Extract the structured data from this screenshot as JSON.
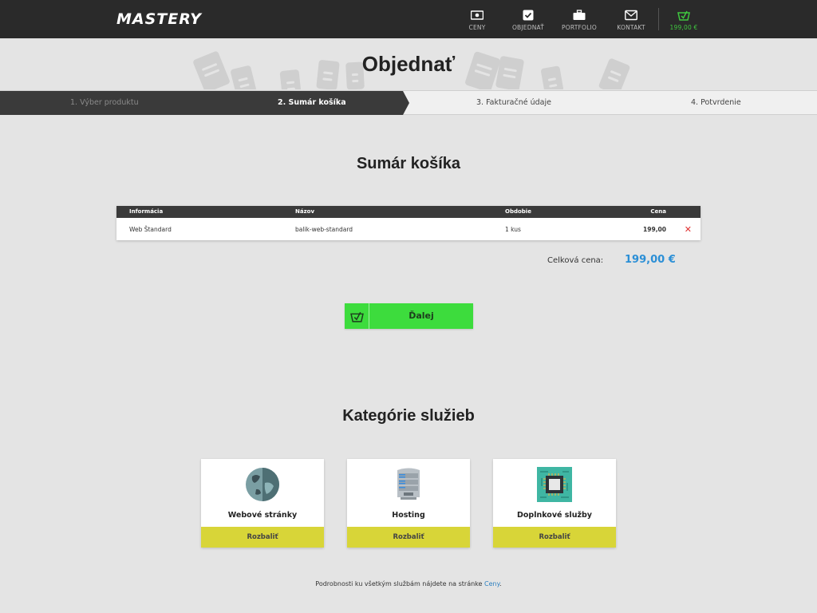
{
  "brand": {
    "logo_text": "MASTERY"
  },
  "nav": {
    "items": [
      {
        "label": "CENY",
        "icon": "banknote-icon"
      },
      {
        "label": "OBJEDNAŤ",
        "icon": "checkbox-icon"
      },
      {
        "label": "PORTFOLIO",
        "icon": "briefcase-icon"
      },
      {
        "label": "KONTAKT",
        "icon": "envelope-icon"
      }
    ],
    "cart": {
      "label": "199,00 €",
      "icon": "basket-icon"
    }
  },
  "page": {
    "title": "Objednať"
  },
  "steps": [
    {
      "label": "1. Výber produktu"
    },
    {
      "label": "2. Sumár košíka"
    },
    {
      "label": "3. Fakturačné údaje"
    },
    {
      "label": "4. Potvrdenie"
    }
  ],
  "cart_summary": {
    "title": "Sumár košíka",
    "columns": [
      "Informácia",
      "Názov",
      "Obdobie",
      "Cena"
    ],
    "rows": [
      {
        "info": "Web Štandard",
        "name": "balik-web-standard",
        "period": "1 kus",
        "price": "199,00"
      }
    ],
    "total_label": "Celková cena:",
    "total_value": "199,00 €",
    "next_label": "Ďalej"
  },
  "categories": {
    "title": "Kategórie služieb",
    "items": [
      {
        "name": "Webové stránky",
        "button": "Rozbaliť",
        "icon": "globe-icon"
      },
      {
        "name": "Hosting",
        "button": "Rozbaliť",
        "icon": "server-icon"
      },
      {
        "name": "Doplnkové služby",
        "button": "Rozbaliť",
        "icon": "chip-icon"
      }
    ]
  },
  "footer": {
    "text": "Podrobnosti ku všetkým službám nájdete na stránke ",
    "link": "Ceny",
    "end": "."
  },
  "colors": {
    "accent_green": "#3ddc3d",
    "total_blue": "#2b8fd6",
    "card_button": "#d8d538",
    "topbar": "#2a2a2a"
  }
}
